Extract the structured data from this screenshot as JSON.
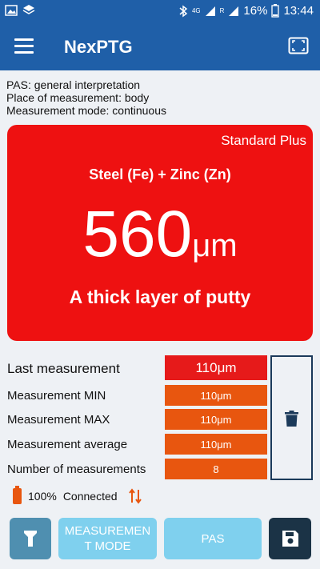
{
  "status_bar": {
    "icons_left": [
      "image-icon",
      "layers-icon"
    ],
    "icons_right": [
      "bluetooth-icon",
      "signal-4g-icon",
      "signal-r-icon"
    ],
    "network_top": "4G",
    "network_sub": "R",
    "battery": "16%",
    "time": "13:44"
  },
  "app_bar": {
    "title": "NexPTG"
  },
  "info": {
    "pas": "PAS: general interpretation",
    "place": "Place of measurement: body",
    "mode": "Measurement mode: continuous"
  },
  "card": {
    "standard": "Standard Plus",
    "material": "Steel (Fe) + Zinc (Zn)",
    "value": "560",
    "unit": "μm",
    "description": "A thick layer of putty",
    "color": "#ee1111"
  },
  "stats": {
    "last_label": "Last measurement",
    "last_value": "110μm",
    "min_label": "Measurement MIN",
    "min_value": "110μm",
    "max_label": "Measurement MAX",
    "max_value": "110μm",
    "avg_label": "Measurement average",
    "avg_value": "110μm",
    "count_label": "Number of measurements",
    "count_value": "8"
  },
  "connection": {
    "battery": "100%",
    "status": "Connected"
  },
  "buttons": {
    "mode": "MEASUREMEN T MODE",
    "pas": "PAS"
  },
  "colors": {
    "primary": "#1f5fa8",
    "accent_orange": "#e8560f",
    "button_light": "#7fd0ee",
    "button_dark": "#1b3346"
  }
}
